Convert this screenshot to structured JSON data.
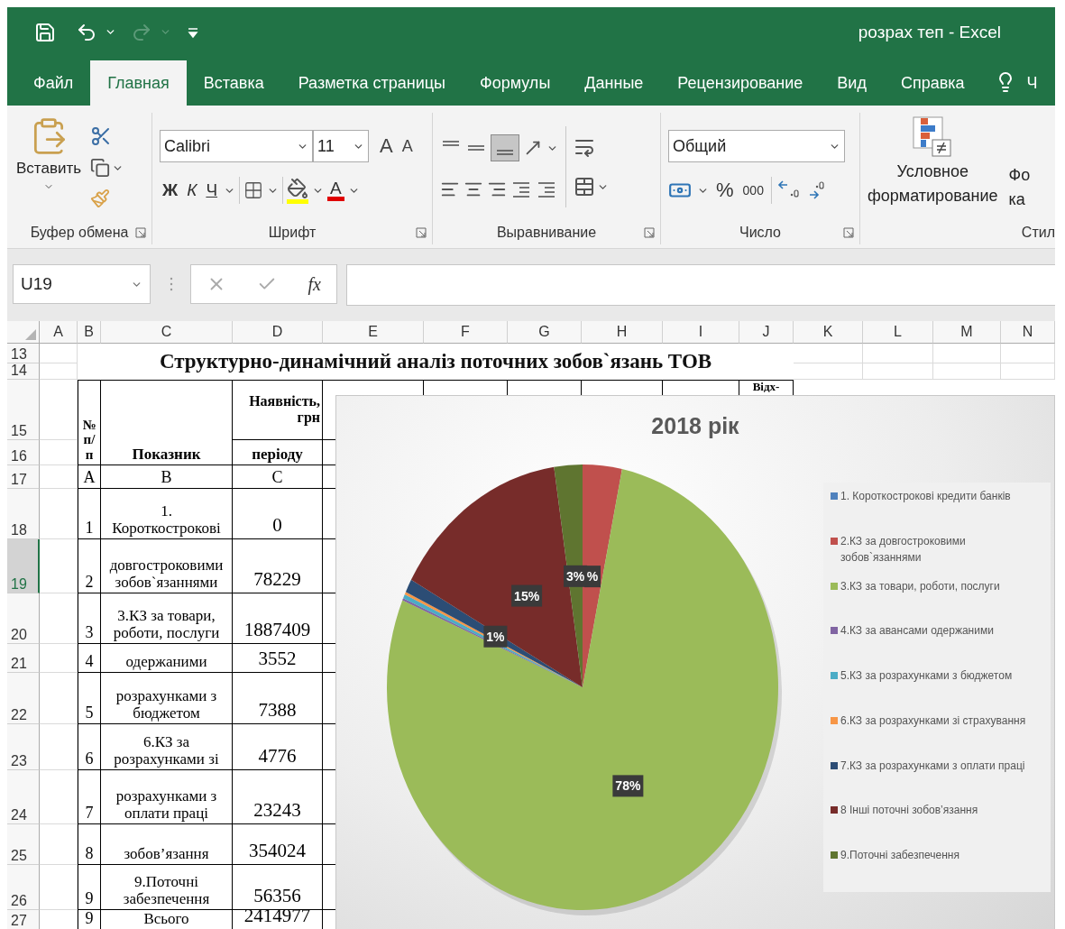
{
  "title_bar": {
    "title": "розрах теп - Excel"
  },
  "tabs": [
    {
      "label": "Файл",
      "selected": false
    },
    {
      "label": "Главная",
      "selected": true
    },
    {
      "label": "Вставка",
      "selected": false
    },
    {
      "label": "Разметка страницы",
      "selected": false
    },
    {
      "label": "Формулы",
      "selected": false
    },
    {
      "label": "Данные",
      "selected": false
    },
    {
      "label": "Рецензирование",
      "selected": false
    },
    {
      "label": "Вид",
      "selected": false
    },
    {
      "label": "Справка",
      "selected": false
    }
  ],
  "tell_me": {
    "label": "Ч"
  },
  "ribbon": {
    "clipboard": {
      "paste": "Вставить",
      "group": "Буфер обмена"
    },
    "font": {
      "name": "Calibri",
      "size": "11",
      "grow": "A",
      "shrink": "A",
      "bold": "Ж",
      "italic": "К",
      "underline": "Ч",
      "font_color": "A",
      "group": "Шрифт"
    },
    "alignment": {
      "bottom_align_selected": true,
      "group": "Выравнивание"
    },
    "number": {
      "format": "Общий",
      "percent": "%",
      "thousands": "000",
      "group": "Число"
    },
    "styles": {
      "conditional": "Условное\nформатирование",
      "next_button": "Фо\nка",
      "group": "Стил"
    }
  },
  "formula_bar": {
    "name_box": "U19",
    "function_label": "fx"
  },
  "sheet": {
    "columns": [
      "A",
      "B",
      "C",
      "D",
      "E",
      "F",
      "G",
      "H",
      "I",
      "J",
      "K",
      "L",
      "M",
      "N"
    ],
    "rows": [
      {
        "number": "13",
        "selected": false
      },
      {
        "number": "14",
        "selected": false
      },
      {
        "number": "15",
        "selected": false
      },
      {
        "number": "16",
        "selected": false
      },
      {
        "number": "17",
        "selected": false
      },
      {
        "number": "18",
        "selected": false
      },
      {
        "number": "19",
        "selected": true
      },
      {
        "number": "20",
        "selected": false
      },
      {
        "number": "21",
        "selected": false
      },
      {
        "number": "22",
        "selected": false
      },
      {
        "number": "23",
        "selected": false
      },
      {
        "number": "24",
        "selected": false
      },
      {
        "number": "25",
        "selected": false
      },
      {
        "number": "26",
        "selected": false
      },
      {
        "number": "27",
        "selected": false
      }
    ],
    "title": "Структурно-динамічний аналіз поточних зобов`язань ТОВ",
    "table": {
      "header": {
        "number": "№\nп/\nп",
        "indicator": "Показник",
        "amount": "Наявність,\nгрн",
        "period": "періоду",
        "column_j": "Відх-"
      },
      "letters": [
        "А",
        "В",
        "С"
      ],
      "rows": [
        {
          "number": "1",
          "indicator": "1.\nКороткострокові",
          "value": "0"
        },
        {
          "number": "2",
          "indicator": "довгостроковими\nзобов`язаннями",
          "value": "78229"
        },
        {
          "number": "3",
          "indicator": "3.КЗ за товари,\nроботи, послуги",
          "value": "1887409"
        },
        {
          "number": "4",
          "indicator": "одержаними",
          "value": "3552"
        },
        {
          "number": "5",
          "indicator": "розрахунками з\nбюджетом",
          "value": "7388"
        },
        {
          "number": "6",
          "indicator": "6.КЗ за\nрозрахунками зі",
          "value": "4776"
        },
        {
          "number": "7",
          "indicator": "розрахунками з\nоплати праці",
          "value": "23243"
        },
        {
          "number": "8",
          "indicator": "зобов’язання",
          "value": "354024"
        },
        {
          "number": "9",
          "indicator": "9.Поточні\nзабезпечення",
          "value": "56356"
        },
        {
          "number": "9",
          "indicator": "Всього",
          "value": "2414977"
        }
      ]
    },
    "chart": {
      "chart_data": {
        "type": "pie",
        "title": "2018 рік",
        "categories": [
          "1. Короткострокові кредити банків",
          "2.КЗ за довгостроковими зобов`язаннями",
          "3.КЗ за товари, роботи, послуги",
          "4.КЗ  за авансами одержаними",
          "5.КЗ  за розрахунками з бюджетом",
          "6.КЗ за розрахунками зі страхування",
          "7.КЗ за розрахунками з оплати праці",
          "8 Інші поточні зобов’язання",
          "9.Поточні забезпечення"
        ],
        "colors": [
          "#4f81bd",
          "#c0504d",
          "#9bbb59",
          "#8064a2",
          "#4bacc6",
          "#f79646",
          "#2c4d75",
          "#772c2a",
          "#5f7530"
        ],
        "series": [
          {
            "values": [
              0,
              3.24,
              78.15,
              0.15,
              0.31,
              0.2,
              0.96,
              14.66,
              2.33
            ]
          }
        ],
        "legend": true,
        "value_labels": [
          null,
          "%",
          "78%",
          null,
          null,
          null,
          "1%",
          "15%",
          "3%"
        ]
      }
    }
  }
}
